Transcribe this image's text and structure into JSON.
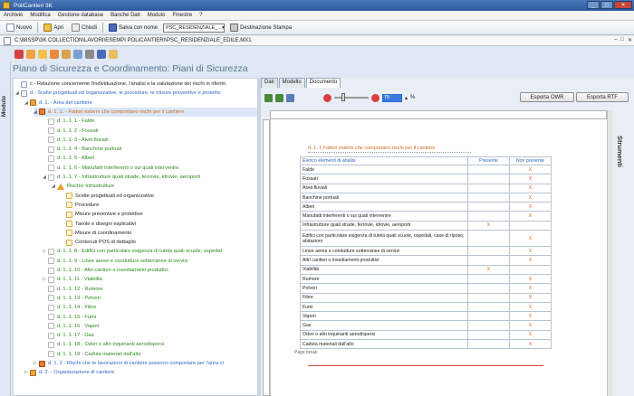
{
  "window": {
    "title": "PoliCantieri 3K",
    "min": "_",
    "max": "□",
    "close": "✕"
  },
  "menu": [
    "Archivio",
    "Modifica",
    "Gestione database",
    "Banche Dati",
    "Modulo",
    "Finestre",
    "?"
  ],
  "toolbar": {
    "nuovo": "Nuovo",
    "apri": "Apri",
    "chiudi": "Chiudi",
    "salva_nome": "Salva con nome",
    "select_value": "PSC_RESIDENZIALE_...",
    "destinazione": "Destinazione Stampa"
  },
  "path": "C:\\88SSP\\3K COLLECTION\\LAVORI\\ESEMPI POLICANTIERI\\PSC_RESIDENZIALE_EDILE.MX1",
  "path_buttons": {
    "minimize": "–",
    "maximize": "□",
    "close": "✕"
  },
  "side_tab": "Modulo",
  "heading": "Piano di Sicurezza e Coordinamento: Piani di Sicurezza",
  "tree": [
    {
      "text": "c - Relazione concernente l'individuazione, l'analisi e la valutazione dei rischi in riferim",
      "color": "black",
      "indent": 0,
      "icon": "doc",
      "exp": ""
    },
    {
      "text": "d - Scelte progettuali ed organizzative, le procedure, le misure preventive e protettiv",
      "color": "blue",
      "indent": 0,
      "icon": "doc",
      "exp": "◢"
    },
    {
      "text": "d. 1. - Area del cantiere",
      "color": "blue",
      "indent": 1,
      "icon": "orange",
      "exp": "◢"
    },
    {
      "text": "d. 1. 1. - Fattori esterni che comportano rischi per il cantiere",
      "color": "orange",
      "indent": 2,
      "icon": "grid",
      "exp": "◢",
      "sel": true
    },
    {
      "text": "d. 1. 1. 1 - Falde",
      "color": "green",
      "indent": 3,
      "icon": "page",
      "exp": ""
    },
    {
      "text": "d. 1. 1. 2 - Fossati",
      "color": "green",
      "indent": 3,
      "icon": "page",
      "exp": ""
    },
    {
      "text": "d. 1. 1. 3 - Alvei fluviali",
      "color": "green",
      "indent": 3,
      "icon": "page",
      "exp": ""
    },
    {
      "text": "d. 1. 1. 4 - Banchine portuali",
      "color": "green",
      "indent": 3,
      "icon": "page",
      "exp": ""
    },
    {
      "text": "d. 1. 1. 5 - Alberi",
      "color": "green",
      "indent": 3,
      "icon": "page",
      "exp": ""
    },
    {
      "text": "d. 1. 1. 6 - Manufatti interferenti o sui quali intervenire",
      "color": "green",
      "indent": 3,
      "icon": "page",
      "exp": ""
    },
    {
      "text": "d. 1. 1. 7 - Infrastrutture quali strade, ferrovie, idrovie, aeroporti",
      "color": "green",
      "indent": 3,
      "icon": "page",
      "exp": "◢"
    },
    {
      "text": "Rischio Infrastrutture",
      "color": "green",
      "indent": 4,
      "icon": "warn",
      "exp": "◢"
    },
    {
      "text": "Scelte progettuali ed organizzative",
      "color": "black",
      "indent": 5,
      "icon": "pagey",
      "exp": ""
    },
    {
      "text": "Procedure",
      "color": "black",
      "indent": 5,
      "icon": "pagey",
      "exp": ""
    },
    {
      "text": "Misure preventive e protettive",
      "color": "black",
      "indent": 5,
      "icon": "pagey",
      "exp": ""
    },
    {
      "text": "Tavole e disegni esplicativi",
      "color": "black",
      "indent": 5,
      "icon": "pagey",
      "exp": ""
    },
    {
      "text": "Misure di coordinamento",
      "color": "black",
      "indent": 5,
      "icon": "pagey",
      "exp": ""
    },
    {
      "text": "Contenuti POS di dettaglio",
      "color": "black",
      "indent": 5,
      "icon": "pagey",
      "exp": ""
    },
    {
      "text": "d. 1. 1. 8 - Edifici con particolare esigenza di tutela quali scuole, ospedal",
      "color": "green",
      "indent": 3,
      "icon": "page",
      "exp": "▷"
    },
    {
      "text": "d. 1. 1. 9 - Linee aeree e condutture sotterranee di servizi",
      "color": "green",
      "indent": 3,
      "icon": "page",
      "exp": ""
    },
    {
      "text": "d. 1. 1. 10 - Altri cantieri o insediamenti produttivi",
      "color": "green",
      "indent": 3,
      "icon": "page",
      "exp": ""
    },
    {
      "text": "d. 1. 1. 11 - Viabilità",
      "color": "green",
      "indent": 3,
      "icon": "page",
      "exp": "▷"
    },
    {
      "text": "d. 1. 1. 12 - Rumore",
      "color": "green",
      "indent": 3,
      "icon": "page",
      "exp": ""
    },
    {
      "text": "d. 1. 1. 13 - Polveri",
      "color": "green",
      "indent": 3,
      "icon": "page",
      "exp": ""
    },
    {
      "text": "d. 1. 1. 14 - Fibre",
      "color": "green",
      "indent": 3,
      "icon": "page",
      "exp": ""
    },
    {
      "text": "d. 1. 1. 15 - Fumi",
      "color": "green",
      "indent": 3,
      "icon": "page",
      "exp": ""
    },
    {
      "text": "d. 1. 1. 16 - Vapori",
      "color": "green",
      "indent": 3,
      "icon": "page",
      "exp": ""
    },
    {
      "text": "d. 1. 1. 17 - Gas",
      "color": "green",
      "indent": 3,
      "icon": "page",
      "exp": ""
    },
    {
      "text": "d. 1. 1. 18 - Odori o altri inquinanti aerodispersi",
      "color": "green",
      "indent": 3,
      "icon": "page",
      "exp": ""
    },
    {
      "text": "d. 1. 1. 19 - Caduta materiali dall'alto",
      "color": "green",
      "indent": 3,
      "icon": "page",
      "exp": ""
    },
    {
      "text": "d. 1. 2 - Rischi che le lavorazioni di cantiere possono comportare per l'area ci",
      "color": "blue",
      "indent": 2,
      "icon": "grid",
      "exp": "▷"
    },
    {
      "text": "d. 2. - Organizzazione di cantiere",
      "color": "blue",
      "indent": 1,
      "icon": "orange",
      "exp": "▷"
    }
  ],
  "tabs": [
    "Dati",
    "Modello",
    "Documento"
  ],
  "zoom": "75",
  "zoom_unit": "%",
  "export_odt": "Esporta OWR",
  "export_rtf": "Esporta RTF",
  "strumenti": "Strumenti",
  "doc": {
    "title": "d. 1. 1 Fattori esterni che comportano rischi per il cantiere",
    "headers": [
      "Elenco elementi di analisi",
      "Presente",
      "Non presente"
    ],
    "rows": [
      [
        "Falde",
        "",
        "X"
      ],
      [
        "Fossati",
        "",
        "X"
      ],
      [
        "Alvei fluviali",
        "",
        "X"
      ],
      [
        "Banchine portuali",
        "",
        "X"
      ],
      [
        "Alberi",
        "",
        "X"
      ],
      [
        "Manufatti interferenti o sui quali intervenire",
        "",
        "X"
      ],
      [
        "Infrastrutture quali strade, ferrovie, idrovie, aeroporti",
        "X",
        ""
      ],
      [
        "Edifici con particolare esigenza di tutela quali scuole, ospedali, case di riposo, abitazioni",
        "",
        "X"
      ],
      [
        "Linee aeree e condutture sotterranee di servizi",
        "",
        "X"
      ],
      [
        "Altri cantieri o insediamenti produttivi",
        "",
        "X"
      ],
      [
        "Viabilità",
        "X",
        ""
      ],
      [
        "Rumore",
        "",
        "X"
      ],
      [
        "Polveri",
        "",
        "X"
      ],
      [
        "Fibre",
        "",
        "X"
      ],
      [
        "Fumi",
        "",
        "X"
      ],
      [
        "Vapori",
        "",
        "X"
      ],
      [
        "Gas",
        "",
        "X"
      ],
      [
        "Odori o altri inquinanti aerodispersi",
        "",
        "X"
      ],
      [
        "Caduta materiali dall'alto",
        "",
        "X"
      ]
    ],
    "page_break": "Page break"
  }
}
